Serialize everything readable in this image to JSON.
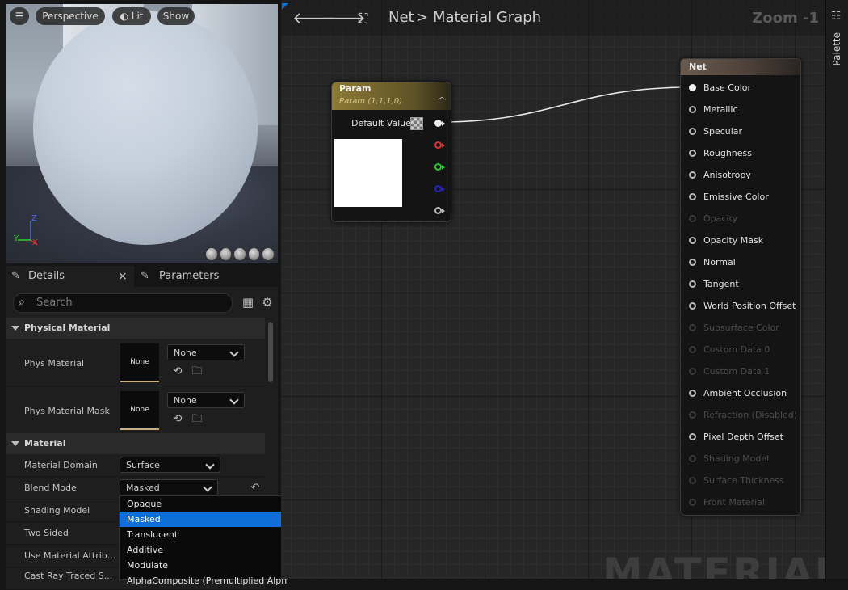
{
  "viewport": {
    "buttons": [
      {
        "label": ""
      },
      {
        "label": "Perspective"
      },
      {
        "label": "Lit"
      },
      {
        "label": "Show"
      }
    ],
    "axes": {
      "x": "X",
      "y": "Y",
      "z": "Z"
    },
    "colors": {
      "x": "#e03030",
      "y": "#30d030",
      "z": "#4a6cff"
    }
  },
  "details": {
    "tabs": [
      {
        "label": "Details"
      },
      {
        "label": "Parameters"
      }
    ],
    "close_glyph": "×",
    "search_placeholder": "Search",
    "sections": {
      "physical_material": "Physical Material",
      "material": "Material"
    },
    "phys_material": {
      "label": "Phys Material",
      "thumb": "None",
      "value": "None"
    },
    "phys_material_mask": {
      "label": "Phys Material Mask",
      "thumb": "None",
      "value": "None"
    },
    "material_domain": {
      "label": "Material Domain",
      "value": "Surface"
    },
    "blend_mode": {
      "label": "Blend Mode",
      "value": "Masked"
    },
    "shading_model": {
      "label": "Shading Model"
    },
    "two_sided": {
      "label": "Two Sided"
    },
    "use_material_attributes": {
      "label": "Use Material Attrib..."
    },
    "cast_ray_traced": {
      "label": "Cast Ray Traced S..."
    }
  },
  "dropdown": {
    "options": [
      "Opaque",
      "Masked",
      "Translucent",
      "Additive",
      "Modulate",
      "AlphaComposite (Premultiplied Alpha)"
    ],
    "selected": "Masked",
    "accent": "#0f6fd8"
  },
  "graph": {
    "breadcrumb": {
      "root": "Net",
      "separator": ">",
      "current": "Material Graph"
    },
    "zoom": "Zoom -1",
    "watermark": "MATERIAL",
    "param_node": {
      "title": "Param",
      "subtitle": "Param (1,1,1,0)",
      "default_label": "Default Value",
      "preview_color": "#ffffff"
    },
    "net_node": {
      "title": "Net",
      "inputs": [
        {
          "name": "Base Color",
          "enabled": true,
          "connected": true
        },
        {
          "name": "Metallic",
          "enabled": true
        },
        {
          "name": "Specular",
          "enabled": true
        },
        {
          "name": "Roughness",
          "enabled": true
        },
        {
          "name": "Anisotropy",
          "enabled": true
        },
        {
          "name": "Emissive Color",
          "enabled": true
        },
        {
          "name": "Opacity",
          "enabled": false
        },
        {
          "name": "Opacity Mask",
          "enabled": true
        },
        {
          "name": "Normal",
          "enabled": true
        },
        {
          "name": "Tangent",
          "enabled": true
        },
        {
          "name": "World Position Offset",
          "enabled": true
        },
        {
          "name": "Subsurface Color",
          "enabled": false
        },
        {
          "name": "Custom Data 0",
          "enabled": false
        },
        {
          "name": "Custom Data 1",
          "enabled": false
        },
        {
          "name": "Ambient Occlusion",
          "enabled": true
        },
        {
          "name": "Refraction (Disabled)",
          "enabled": false
        },
        {
          "name": "Pixel Depth Offset",
          "enabled": true
        },
        {
          "name": "Shading Model",
          "enabled": false
        },
        {
          "name": "Surface Thickness",
          "enabled": false
        },
        {
          "name": "Front Material",
          "enabled": false
        }
      ]
    }
  },
  "palette": {
    "label": "Palette"
  }
}
